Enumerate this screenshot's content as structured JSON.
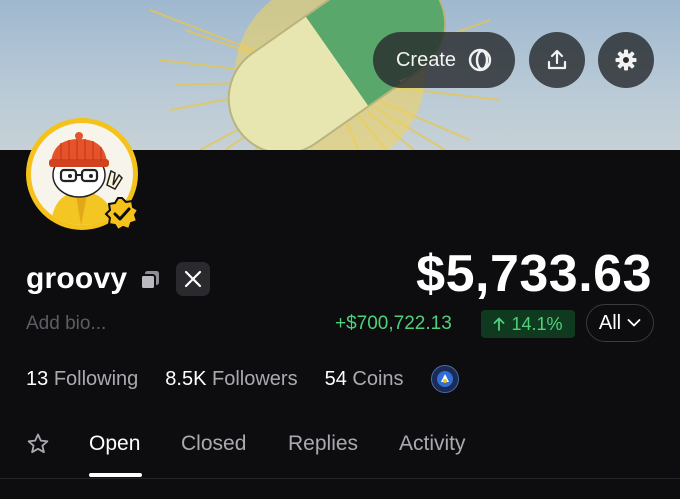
{
  "header": {
    "create_label": "Create",
    "create_icon": "circle-logo-icon",
    "upload_icon": "upload-icon",
    "settings_icon": "gear-icon"
  },
  "profile": {
    "username": "groovy",
    "bio_placeholder": "Add bio...",
    "verified": true
  },
  "portfolio": {
    "balance": "$5,733.63",
    "pnl": "+$700,722.13",
    "pnl_percent": "14.1%",
    "range": "All"
  },
  "stats": [
    {
      "value": "13",
      "label": "Following"
    },
    {
      "value": "8.5K",
      "label": "Followers"
    },
    {
      "value": "54",
      "label": "Coins"
    }
  ],
  "tabs": [
    "Open",
    "Closed",
    "Replies",
    "Activity"
  ],
  "active_tab": "Open",
  "colors": {
    "background": "#0d0d10",
    "positive": "#4fd07b",
    "avatar_ring": "#f4c21b",
    "muted": "#a9a9b0"
  }
}
